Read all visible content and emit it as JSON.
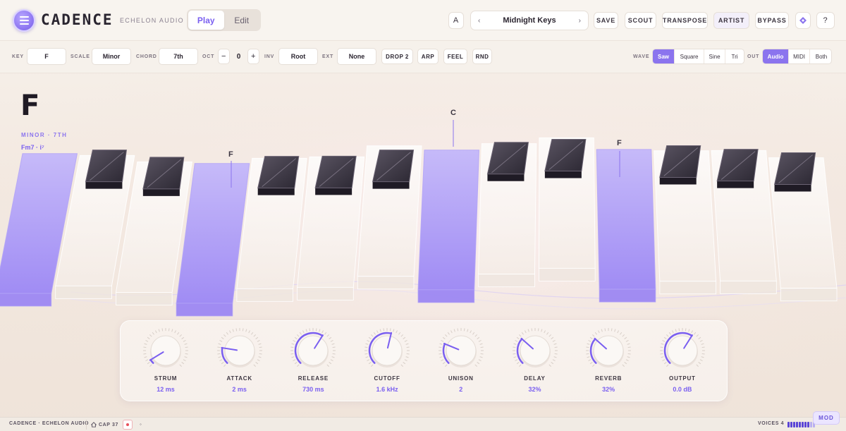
{
  "header": {
    "brand": "CADENCE",
    "brand_sub": "ECHELON AUDIO",
    "modes": [
      "Play",
      "Edit"
    ],
    "active_mode": "Play",
    "slot": "A",
    "preset_name": "Midnight Keys",
    "prev_glyph": "‹",
    "next_glyph": "›",
    "buttons": {
      "save": "SAVE",
      "scout": "SCOUT",
      "transpose": "TRANSPOSE",
      "artist": "ARTIST",
      "bypass": "BYPASS"
    },
    "help": "?",
    "icons": {
      "menu": "hamburger-icon",
      "diamond": "diamond-icon"
    }
  },
  "toolbar": {
    "key_label": "KEY",
    "key_value": "F",
    "scale_label": "SCALE",
    "scale_value": "Minor",
    "chord_label": "CHORD",
    "chord_value": "7th",
    "oct_label": "OCT",
    "oct_minus": "−",
    "oct_value": "0",
    "oct_plus": "+",
    "inv_label": "INV",
    "inv_value": "Root",
    "ext_label": "EXT",
    "ext_value": "None",
    "drop2": "DROP 2",
    "arp": "ARP",
    "feel": "FEEL",
    "rnd": "RND",
    "wave_label": "WAVE",
    "waves": [
      "Saw",
      "Square",
      "Sine",
      "Tri"
    ],
    "active_wave": "Saw",
    "out_label": "OUT",
    "outs": [
      "Audio",
      "MIDI",
      "Both"
    ],
    "active_out": "Audio"
  },
  "chord": {
    "root": "F",
    "quality": "MINOR · 7TH",
    "name": "Fm7 · i⁷",
    "note_labels": [
      "F",
      "C",
      "F"
    ]
  },
  "keyboard": {
    "white_keys": 14,
    "pressed_white_indices": [
      0,
      3,
      7,
      10
    ],
    "accent_color": "#a996f7"
  },
  "knobs": [
    {
      "label": "STRUM",
      "value": "12 ms",
      "level": 0.05
    },
    {
      "label": "ATTACK",
      "value": "2 ms",
      "level": 0.2
    },
    {
      "label": "RELEASE",
      "value": "730 ms",
      "level": 0.62
    },
    {
      "label": "CUTOFF",
      "value": "1.6 kHz",
      "level": 0.55
    },
    {
      "label": "UNISON",
      "value": "2",
      "level": 0.25
    },
    {
      "label": "DELAY",
      "value": "32%",
      "level": 0.32
    },
    {
      "label": "REVERB",
      "value": "32%",
      "level": 0.32
    },
    {
      "label": "OUTPUT",
      "value": "0.0 dB",
      "level": 0.62
    }
  ],
  "status": {
    "left": "CADENCE · ECHELON AUDIO",
    "cap": "CAP 37",
    "record_glyph": "●",
    "loop_glyph": "◦",
    "voices": "VOICES 4",
    "mod": "MOD",
    "accent": "#5b45d6"
  }
}
